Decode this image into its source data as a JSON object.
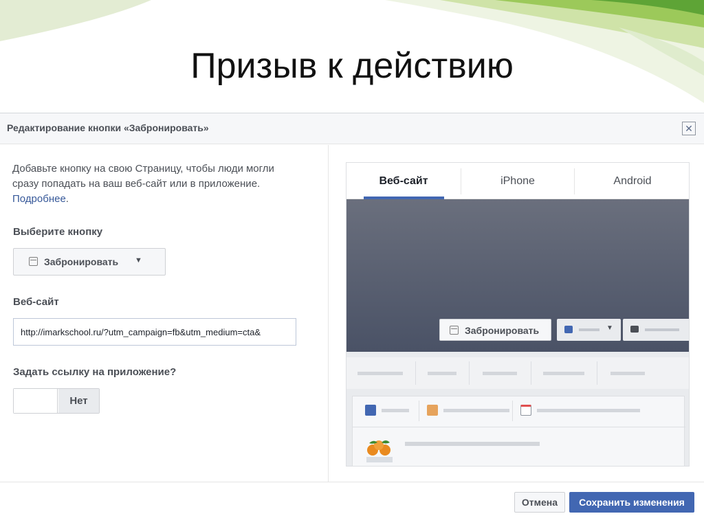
{
  "slide": {
    "title": "Призыв к действию"
  },
  "dialog": {
    "title": "Редактирование кнопки «Забронировать»",
    "close_icon": "close-icon",
    "intro_text": "Добавьте кнопку на свою Страницу, чтобы люди могли сразу попадать на ваш веб-сайт или в приложение. ",
    "intro_link": "Подробнее",
    "intro_end": ".",
    "choose_label": "Выберите кнопку",
    "selected_button": "Забронировать",
    "website_label": "Веб-сайт",
    "website_value": "http://imarkschool.ru/?utm_campaign=fb&utm_medium=cta&",
    "app_link_label": "Задать ссылку на приложение?",
    "app_link_toggle": "Нет",
    "cancel_label": "Отмена",
    "save_label": "Сохранить изменения"
  },
  "preview": {
    "tabs": [
      {
        "label": "Веб-сайт",
        "active": true
      },
      {
        "label": "iPhone",
        "active": false
      },
      {
        "label": "Android",
        "active": false
      }
    ],
    "cta_label": "Забронировать",
    "accent_color": "#4267b2"
  }
}
